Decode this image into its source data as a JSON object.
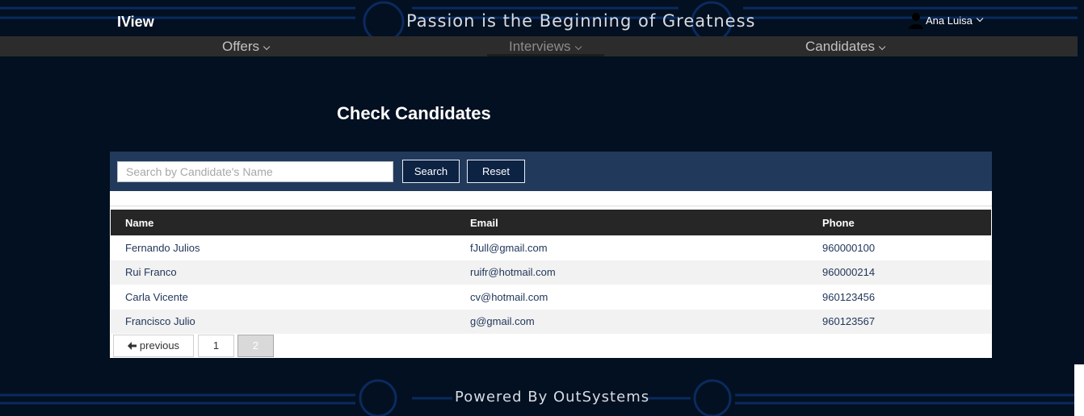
{
  "header": {
    "logo": "IView",
    "slogan": "Passion is the Beginning of Greatness",
    "user_name": "Ana Luisa"
  },
  "nav": {
    "items": [
      {
        "label": "Offers"
      },
      {
        "label": "Interviews"
      },
      {
        "label": "Candidates"
      }
    ],
    "active": "Interviews"
  },
  "page": {
    "title": "Check Candidates"
  },
  "search": {
    "placeholder": "Search by Candidate's Name",
    "value": "",
    "search_label": "Search",
    "reset_label": "Reset"
  },
  "table": {
    "headers": [
      "Name",
      "Email",
      "Phone"
    ],
    "rows": [
      {
        "name": "Fernando Julios",
        "email": "fJull@gmail.com",
        "phone": "960000100"
      },
      {
        "name": "Rui Franco",
        "email": "ruifr@hotmail.com",
        "phone": "960000214"
      },
      {
        "name": "Carla Vicente",
        "email": "cv@hotmail.com",
        "phone": "960123456"
      },
      {
        "name": "Francisco Julio",
        "email": "g@gmail.com",
        "phone": "960123567"
      }
    ]
  },
  "pagination": {
    "previous_label": "previous",
    "pages": [
      "1",
      "2"
    ],
    "current_page": "2"
  },
  "footer": {
    "text": "Powered By OutSystems"
  },
  "colors": {
    "background": "#021021",
    "circuit": "#0a2a5c",
    "search_bar": "#213a5c",
    "table_header": "#262626",
    "menu_bar": "#2c2c2c",
    "link_text": "#1f3559"
  }
}
